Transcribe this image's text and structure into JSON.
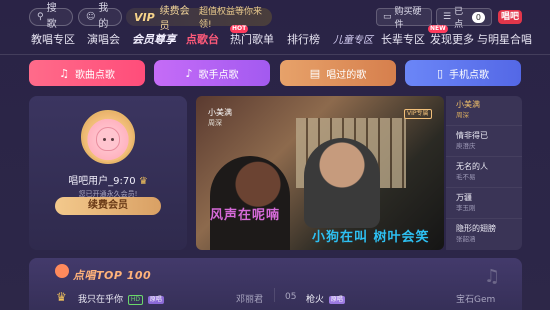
{
  "topbar": {
    "search": "搜歌",
    "mine": "我的",
    "vip_tag": "VIP",
    "vip_text": "续费会员",
    "vip_sub": "超值权益等你来领!",
    "buy_hardware": "购买硬件",
    "connected": "已点",
    "connected_count": "0",
    "logo": "唱吧"
  },
  "nav": {
    "items": [
      "教唱专区",
      "演唱会",
      "会员尊享",
      "点歌台",
      "热门歌单",
      "排行榜",
      "儿童专区",
      "长辈专区",
      "发现更多",
      "与明星合唱"
    ],
    "active_index": 3,
    "badges": {
      "hot": "HOT",
      "new": "NEW"
    }
  },
  "categories": [
    {
      "label": "歌曲点歌",
      "icon": "music-note-icon"
    },
    {
      "label": "歌手点歌",
      "icon": "singer-icon"
    },
    {
      "label": "唱过的歌",
      "icon": "history-icon"
    },
    {
      "label": "手机点歌",
      "icon": "phone-icon"
    }
  ],
  "user": {
    "name": "唱吧用户_9:70",
    "status": "您已开通永久会员!",
    "renew_label": "续费会员"
  },
  "video": {
    "title": "小美满",
    "artist": "周深",
    "vip_label": "VIP专属",
    "lyric_line1": "风声在呢喃",
    "lyric_line2": "小狗在叫 树叶会笑"
  },
  "songlist": [
    {
      "title": "小美满",
      "artist": "周深",
      "active": true
    },
    {
      "title": "情非得已",
      "artist": "庾澄庆"
    },
    {
      "title": "无名的人",
      "artist": "毛不易"
    },
    {
      "title": "万疆",
      "artist": "李玉刚"
    },
    {
      "title": "隐形的翅膀",
      "artist": "张韶涵"
    }
  ],
  "top100": {
    "title": "点唱TOP 100",
    "rows": [
      {
        "title": "我只在乎你",
        "tags": [
          "HD",
          "原唱"
        ],
        "artist": "邓丽君"
      },
      {
        "rank": "05",
        "title": "枪火",
        "tags": [
          "原唱"
        ],
        "artist": "宝石Gem"
      }
    ]
  },
  "colors": {
    "accent": "#ff5a7a",
    "gold": "#f1c15c",
    "background": "#2b2547"
  }
}
